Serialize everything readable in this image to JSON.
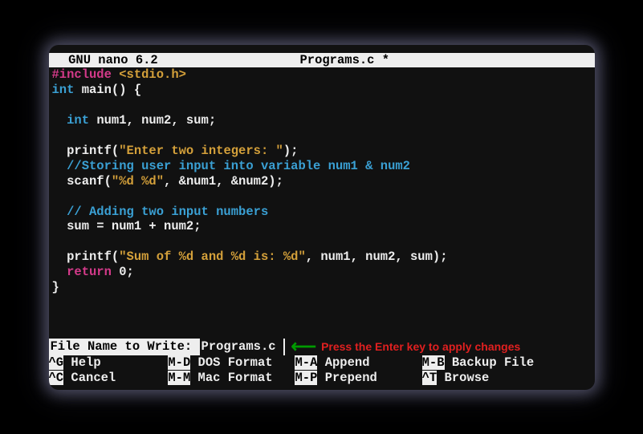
{
  "title": {
    "app": "  GNU nano 6.2",
    "file": "Programs.c *"
  },
  "code": {
    "l1a": "#include",
    "l1b": " <stdio.h>",
    "l2a": "int",
    "l2b": " main() {",
    "l3": "",
    "l4a": "  int",
    "l4b": " num1, num2, sum;",
    "l5": "",
    "l6a": "  printf(",
    "l6b": "\"Enter two integers: \"",
    "l6c": ");",
    "l7": "  //Storing user input into variable num1 & num2",
    "l8a": "  scanf(",
    "l8b": "\"%d %d\"",
    "l8c": ", &num1, &num2);",
    "l9": "",
    "l10": "  // Adding two input numbers",
    "l11": "  sum = num1 + num2;",
    "l12": "",
    "l13a": "  printf(",
    "l13b": "\"Sum of %d and %d is: %d\"",
    "l13c": ", num1, num2, sum);",
    "l14a": "  return",
    "l14b": " 0;",
    "l15": "}"
  },
  "prompt": {
    "label": "File Name to Write: ",
    "value": "Programs.c"
  },
  "annotation": "Press the Enter key to apply changes",
  "shortcuts": {
    "r1k1": "^G",
    "r1l1": " Help         ",
    "r1k2": "M-D",
    "r1l2": " DOS Format   ",
    "r1k3": "M-A",
    "r1l3": " Append       ",
    "r1k4": "M-B",
    "r1l4": " Backup File",
    "r2k1": "^C",
    "r2l1": " Cancel       ",
    "r2k2": "M-M",
    "r2l2": " Mac Format   ",
    "r2k3": "M-P",
    "r2l3": " Prepend      ",
    "r2k4": "^T",
    "r2l4": " Browse"
  }
}
